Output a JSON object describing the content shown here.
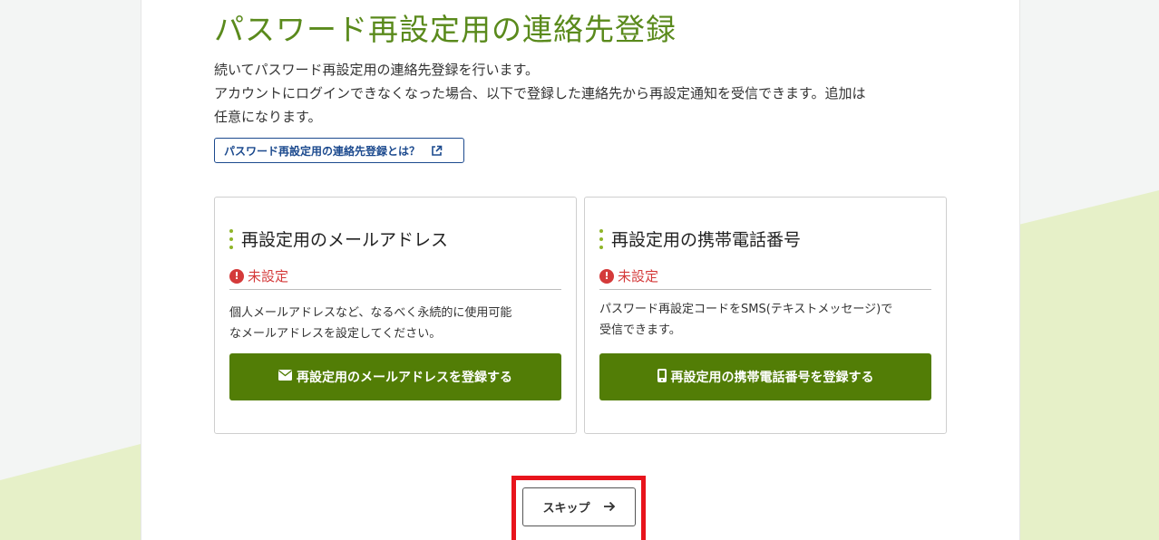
{
  "page": {
    "title": "パスワード再設定用の連絡先登録",
    "description_lines": [
      "続いてパスワード再設定用の連絡先登録を行います。",
      "アカウントにログインできなくなった場合、以下で登録した連絡先から再設定通知を受信できます。追加は",
      "任意になります。"
    ],
    "help_link_label": "パスワード再設定用の連絡先登録とは？",
    "help_link_icon": "external-link-icon"
  },
  "cards": {
    "email": {
      "title": "再設定用のメールアドレス",
      "status": "未設定",
      "text_lines": [
        "個人メールアドレスなど、なるべく永続的に使用可能",
        "なメールアドレスを設定してください。"
      ],
      "button_label": "再設定用のメールアドレスを登録する",
      "button_icon": "envelope-icon"
    },
    "phone": {
      "title": "再設定用の携帯電話番号",
      "status": "未設定",
      "text_lines": [
        "パスワード再設定コードをSMS(テキストメッセージ)で",
        "受信できます。"
      ],
      "button_label": "再設定用の携帯電話番号を登録する",
      "button_icon": "mobile-phone-icon"
    }
  },
  "skip": {
    "label": "スキップ",
    "icon": "arrow-right-icon"
  },
  "colors": {
    "title_green": "#5a8a1c",
    "button_green": "#527d06",
    "accent_dots": "#8fb52a",
    "status_red": "#d43a3a",
    "link_blue": "#1c4a8e",
    "highlight_red": "#e8141c",
    "background_stripe": "#e6f0c8"
  }
}
